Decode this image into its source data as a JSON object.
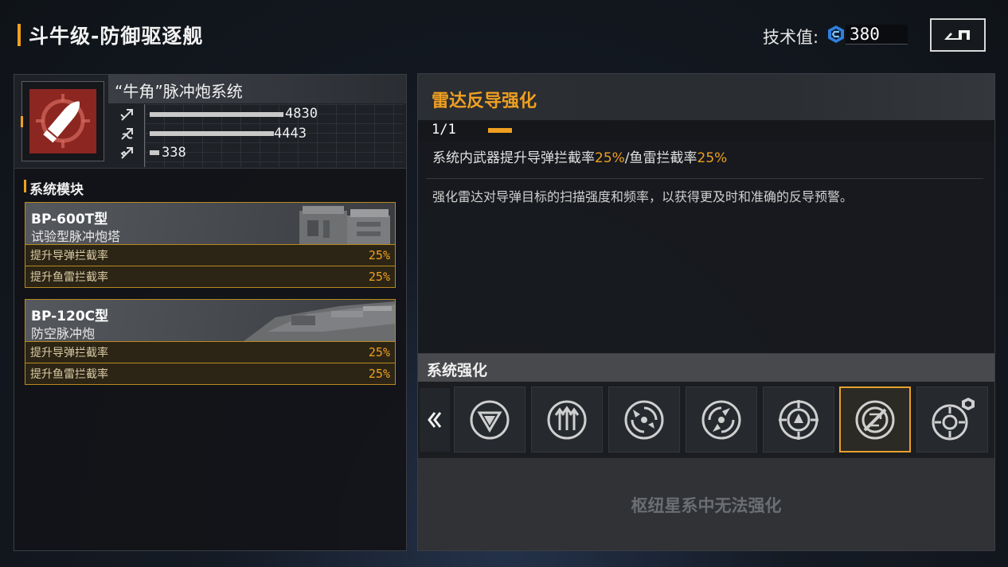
{
  "header": {
    "title": "斗牛级-防御驱逐舰",
    "tech_label": "技术值:",
    "tech_value": "380",
    "tech_icon": "tech-point-icon",
    "back_icon": "back-arrow-icon"
  },
  "weapon": {
    "name": "“牛角”脉冲炮系统",
    "icon": "shell-target-icon",
    "stats": [
      {
        "icon": "anti-missile-icon",
        "value": "4830",
        "fraction": 0.82
      },
      {
        "icon": "anti-torpedo-icon",
        "value": "4443",
        "fraction": 0.76
      },
      {
        "icon": "anti-air-icon",
        "value": "338",
        "fraction": 0.06
      }
    ]
  },
  "modules": {
    "label": "系统模块",
    "items": [
      {
        "code": "BP-600T型",
        "name": "试验型脉冲炮塔",
        "rows": [
          {
            "label": "提升导弹拦截率",
            "value": "25%"
          },
          {
            "label": "提升鱼雷拦截率",
            "value": "25%"
          }
        ]
      },
      {
        "code": "BP-120C型",
        "name": "防空脉冲炮",
        "rows": [
          {
            "label": "提升导弹拦截率",
            "value": "25%"
          },
          {
            "label": "提升鱼雷拦截率",
            "value": "25%"
          }
        ]
      }
    ]
  },
  "upgrade": {
    "title": "雷达反导强化",
    "level": "1/1",
    "effect_prefix": "系统内武器提升导弹拦截率",
    "effect_val1": "25%",
    "effect_mid": "/鱼雷拦截率",
    "effect_val2": "25%",
    "description": "强化雷达对导弹目标的扫描强度和频率，以获得更及时和准确的反导预警。"
  },
  "enhance": {
    "label": "系统强化",
    "scroll_icon": "double-chevron-left-icon",
    "slots": [
      {
        "icon": "delta-arrows-icon",
        "selected": false
      },
      {
        "icon": "triple-arrow-up-icon",
        "selected": false
      },
      {
        "icon": "radar-sweep-icon",
        "selected": false
      },
      {
        "icon": "radar-sweep-alt-icon",
        "selected": false
      },
      {
        "icon": "crosshair-triad-icon",
        "selected": false
      },
      {
        "icon": "radar-antimissile-icon",
        "selected": true
      },
      {
        "icon": "target-lock-shield-icon",
        "selected": false
      }
    ],
    "locked_message": "枢纽星系中无法强化"
  },
  "colors": {
    "accent": "#f0a020",
    "weapon_bg": "#8c2620",
    "panel": "#181a1e"
  }
}
